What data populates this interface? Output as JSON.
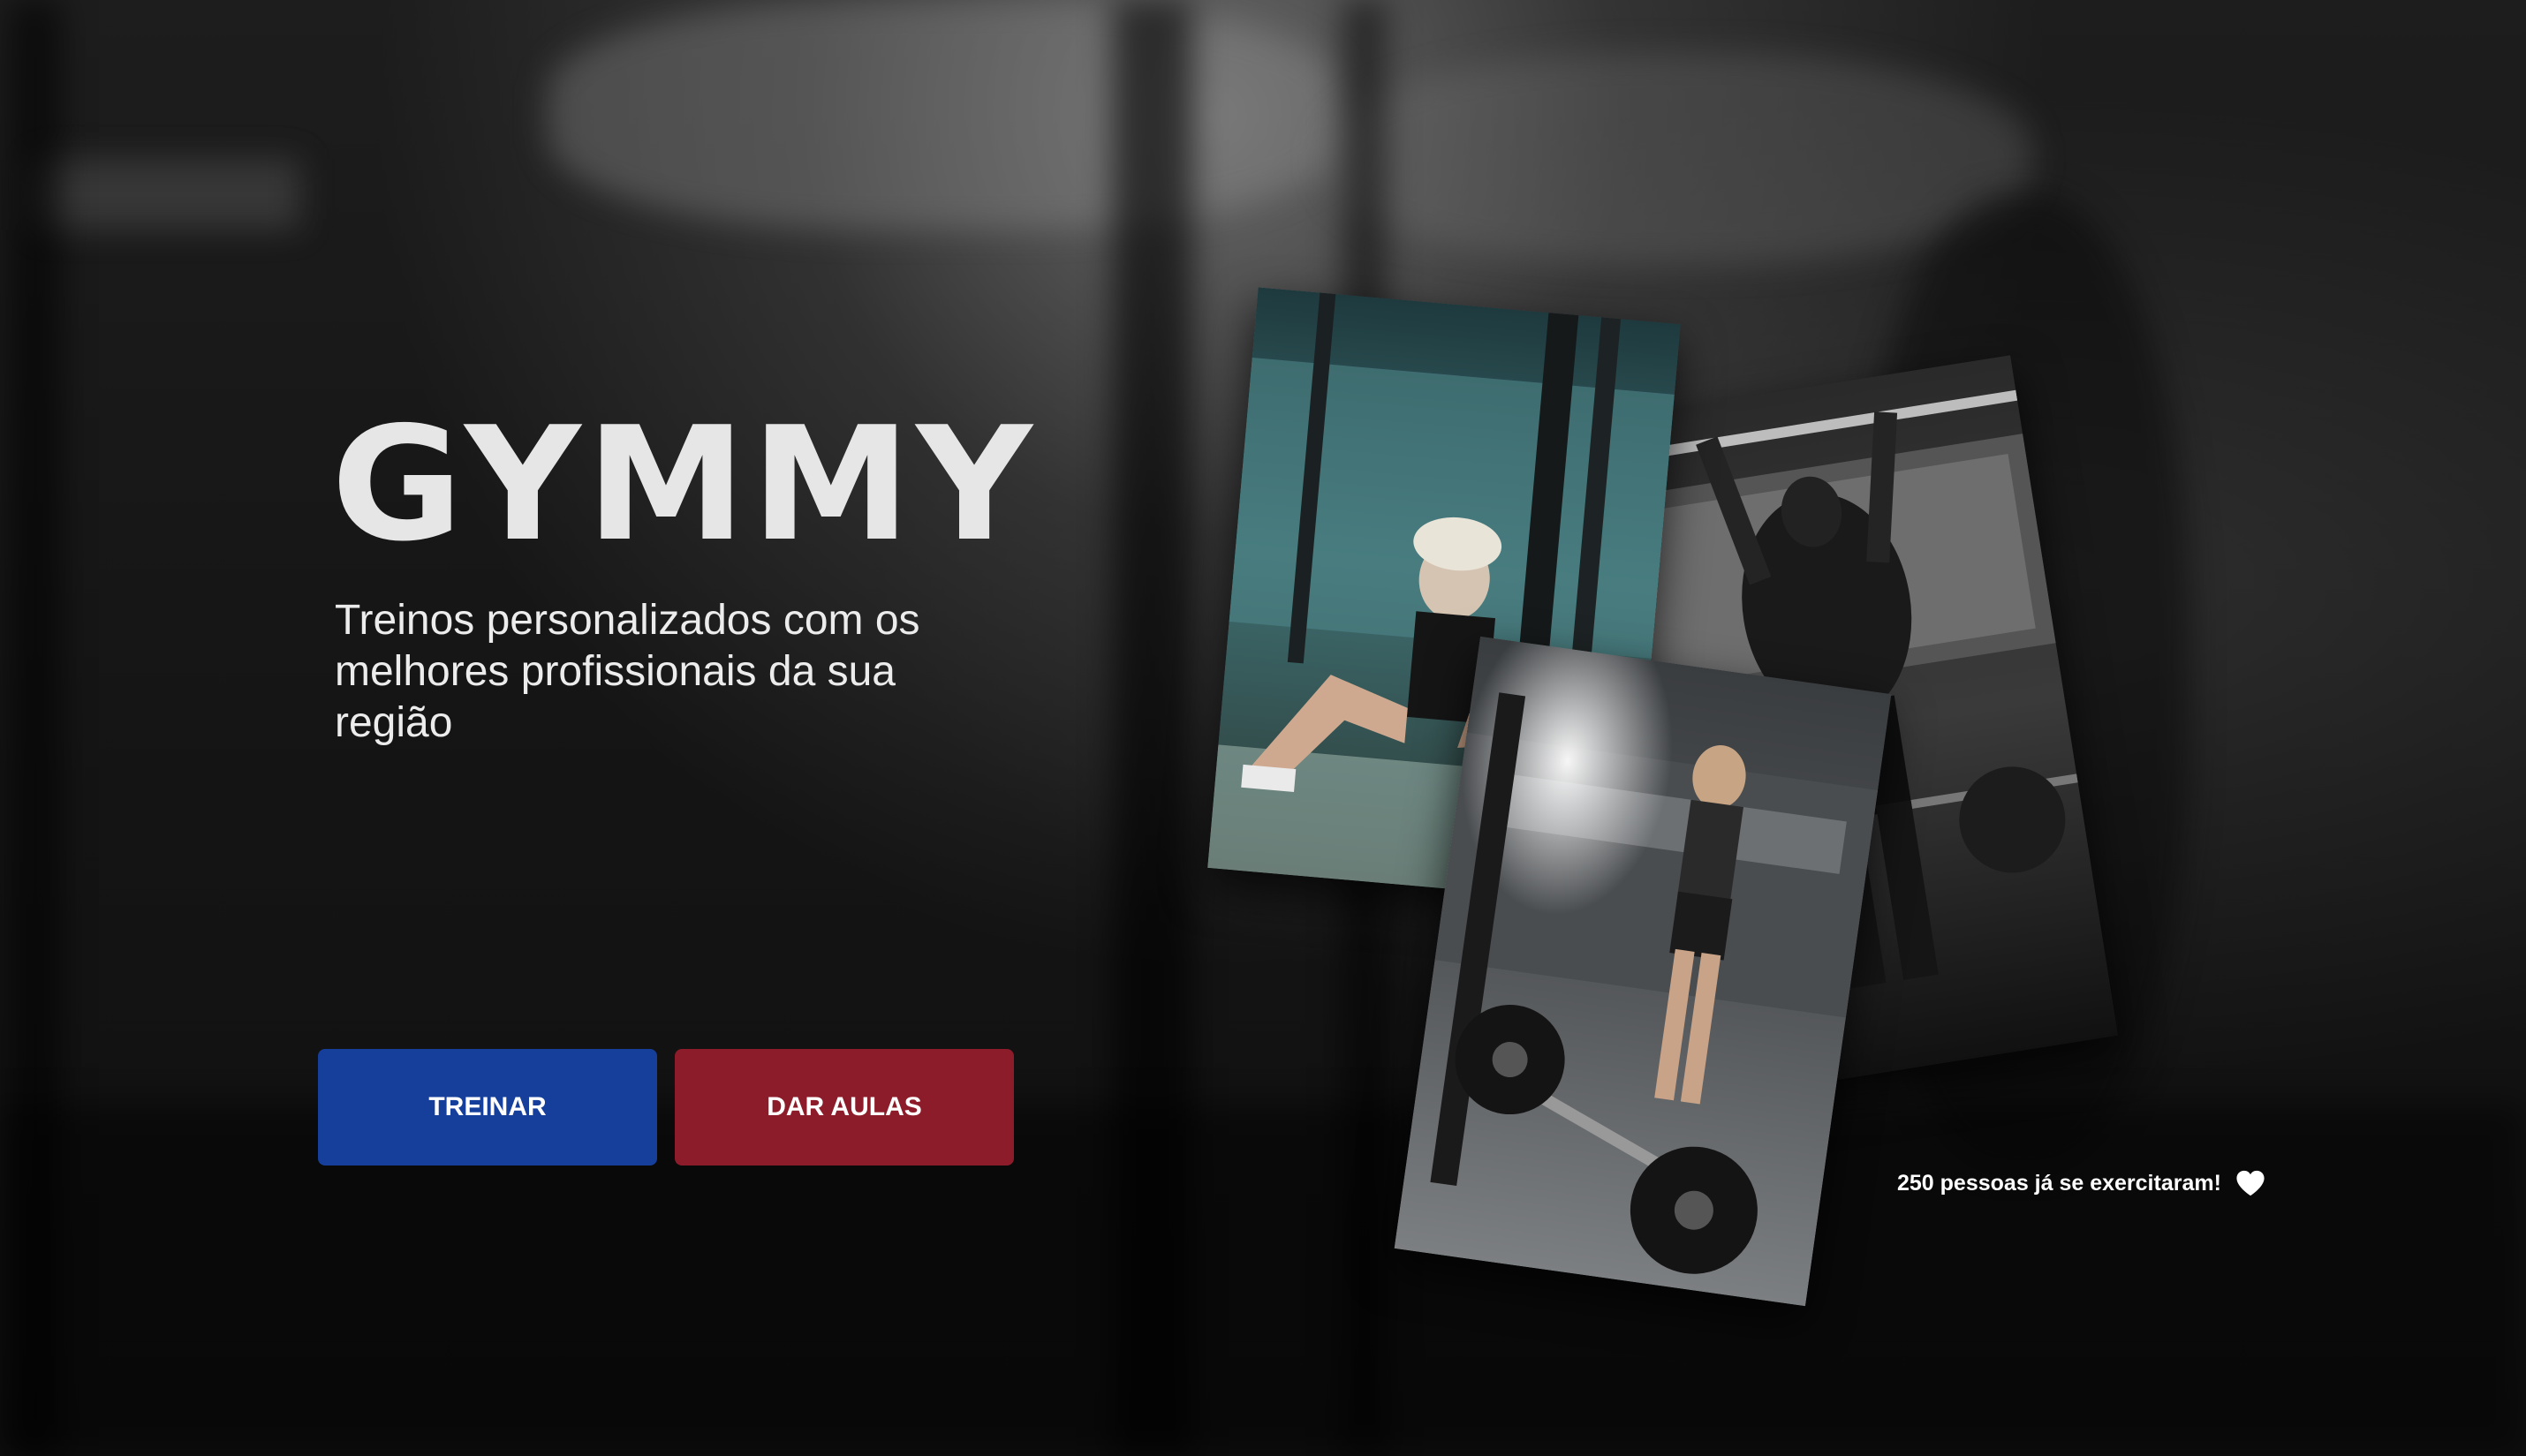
{
  "hero": {
    "title": "GYMMY",
    "subtitle": "Treinos personalizados com os melhores profissionais da sua região"
  },
  "actions": {
    "train_label": "TREINAR",
    "teach_label": "DAR AULAS"
  },
  "counter": {
    "text": "250 pessoas já se exercitaram!",
    "icon": "heart-icon"
  },
  "colors": {
    "train_button": "#163f9b",
    "teach_button": "#8d1c2a",
    "title": "#e6e6e6"
  },
  "photos": [
    {
      "icon": "photo-woman-situps"
    },
    {
      "icon": "photo-man-pullup"
    },
    {
      "icon": "photo-woman-barbell"
    }
  ]
}
